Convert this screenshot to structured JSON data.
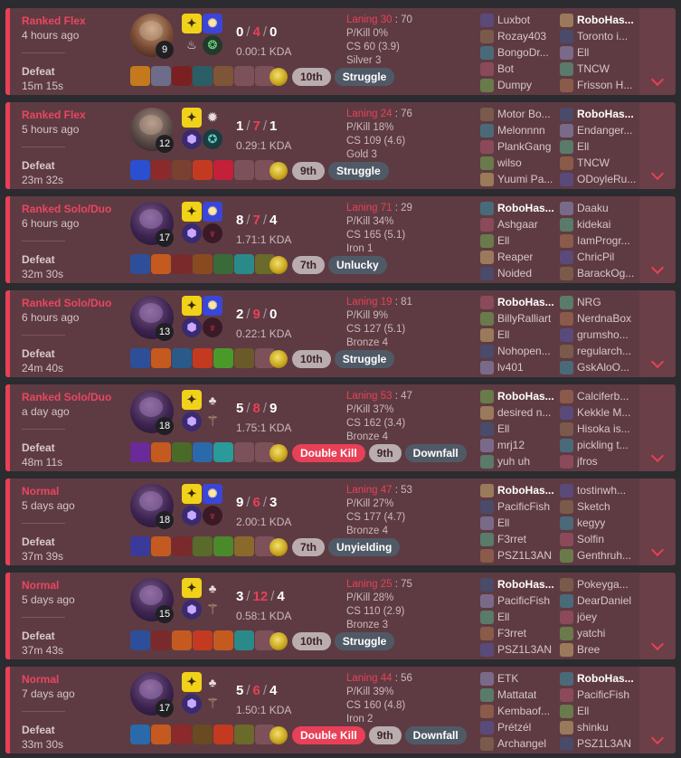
{
  "colors": {
    "loss_accent": "#e84057",
    "card_bg": "#5e3b42"
  },
  "matches": [
    {
      "queue": "Ranked Flex",
      "time_ago": "4 hours ago",
      "result": "Defeat",
      "duration": "15m 15s",
      "level": "9",
      "kills": "0",
      "deaths": "4",
      "assists": "0",
      "kda": "0.00:1 KDA",
      "laning_label": "Laning 30",
      "laning_opp": ": 70",
      "pkill": "P/Kill 0%",
      "cs": "CS 60 (3.9)",
      "rank": "Silver 3",
      "badges": [
        {
          "text": "10th",
          "kind": "rank"
        },
        {
          "text": "Struggle",
          "kind": "perf"
        }
      ],
      "team1": [
        "Luxbot",
        "Rozay403",
        "BongoDr...",
        "Bot",
        "Dumpy"
      ],
      "team2": [
        "RoboHas...",
        "Toronto i...",
        "Ell",
        "TNCW",
        "Frisson H..."
      ]
    },
    {
      "queue": "Ranked Flex",
      "time_ago": "5 hours ago",
      "result": "Defeat",
      "duration": "23m 32s",
      "level": "12",
      "kills": "1",
      "deaths": "7",
      "assists": "1",
      "kda": "0.29:1 KDA",
      "laning_label": "Laning 24",
      "laning_opp": ": 76",
      "pkill": "P/Kill 18%",
      "cs": "CS 109 (4.6)",
      "rank": "Gold 3",
      "badges": [
        {
          "text": "9th",
          "kind": "rank"
        },
        {
          "text": "Struggle",
          "kind": "perf"
        }
      ],
      "team1": [
        "Motor Bo...",
        "Melonnnn",
        "PlankGang",
        "wilso",
        "Yuumi Pa..."
      ],
      "team2": [
        "RoboHas...",
        "Endanger...",
        "Ell",
        "TNCW",
        "ODoyleRu..."
      ]
    },
    {
      "queue": "Ranked Solo/Duo",
      "time_ago": "6 hours ago",
      "result": "Defeat",
      "duration": "32m 30s",
      "level": "17",
      "kills": "8",
      "deaths": "7",
      "assists": "4",
      "kda": "1.71:1 KDA",
      "laning_label": "Laning 71",
      "laning_opp": ": 29",
      "pkill": "P/Kill 34%",
      "cs": "CS 165 (5.1)",
      "rank": "Iron 1",
      "badges": [
        {
          "text": "7th",
          "kind": "rank"
        },
        {
          "text": "Unlucky",
          "kind": "perf"
        }
      ],
      "team1": [
        "RoboHas...",
        "Ashgaar",
        "Ell",
        "Reaper",
        "Noided"
      ],
      "team2": [
        "Daaku",
        "kidekai",
        "IamProgr...",
        "ChricPil",
        "BarackOg..."
      ]
    },
    {
      "queue": "Ranked Solo/Duo",
      "time_ago": "6 hours ago",
      "result": "Defeat",
      "duration": "24m 40s",
      "level": "13",
      "kills": "2",
      "deaths": "9",
      "assists": "0",
      "kda": "0.22:1 KDA",
      "laning_label": "Laning 19",
      "laning_opp": ": 81",
      "pkill": "P/Kill 9%",
      "cs": "CS 127 (5.1)",
      "rank": "Bronze 4",
      "badges": [
        {
          "text": "10th",
          "kind": "rank"
        },
        {
          "text": "Struggle",
          "kind": "perf"
        }
      ],
      "team1": [
        "RoboHas...",
        "BillyRalliart",
        "Ell",
        "Nohopen...",
        "lv401"
      ],
      "team2": [
        "NRG",
        "NerdnaBox",
        "grumsho...",
        "regularch...",
        "GskAloO..."
      ]
    },
    {
      "queue": "Ranked Solo/Duo",
      "time_ago": "a day ago",
      "result": "Defeat",
      "duration": "48m 11s",
      "level": "18",
      "kills": "5",
      "deaths": "8",
      "assists": "9",
      "kda": "1.75:1 KDA",
      "laning_label": "Laning 53",
      "laning_opp": ": 47",
      "pkill": "P/Kill 37%",
      "cs": "CS 162 (3.4)",
      "rank": "Bronze 4",
      "badges": [
        {
          "text": "Double Kill",
          "kind": "mk"
        },
        {
          "text": "9th",
          "kind": "rank"
        },
        {
          "text": "Downfall",
          "kind": "perf"
        }
      ],
      "team1": [
        "RoboHas...",
        "desired n...",
        "Ell",
        "mrj12",
        "yuh uh"
      ],
      "team2": [
        "Calciferb...",
        "Kekkle M...",
        "Hisoka is...",
        "pickling t...",
        "jfros"
      ]
    },
    {
      "queue": "Normal",
      "time_ago": "5 days ago",
      "result": "Defeat",
      "duration": "37m 39s",
      "level": "18",
      "kills": "9",
      "deaths": "6",
      "assists": "3",
      "kda": "2.00:1 KDA",
      "laning_label": "Laning 47",
      "laning_opp": ": 53",
      "pkill": "P/Kill 27%",
      "cs": "CS 177 (4.7)",
      "rank": "Bronze 4",
      "badges": [
        {
          "text": "7th",
          "kind": "rank"
        },
        {
          "text": "Unyielding",
          "kind": "perf"
        }
      ],
      "team1": [
        "RoboHas...",
        "PacificFish",
        "Ell",
        "F3rret",
        "PSZ1L3AN"
      ],
      "team2": [
        "tostinwh...",
        "Sketch",
        "kegyy",
        "Solfin",
        "Genthruh..."
      ]
    },
    {
      "queue": "Normal",
      "time_ago": "5 days ago",
      "result": "Defeat",
      "duration": "37m 43s",
      "level": "15",
      "kills": "3",
      "deaths": "12",
      "assists": "4",
      "kda": "0.58:1 KDA",
      "laning_label": "Laning 25",
      "laning_opp": ": 75",
      "pkill": "P/Kill 28%",
      "cs": "CS 110 (2.9)",
      "rank": "Bronze 3",
      "badges": [
        {
          "text": "10th",
          "kind": "rank"
        },
        {
          "text": "Struggle",
          "kind": "perf"
        }
      ],
      "team1": [
        "RoboHas...",
        "PacificFish",
        "Ell",
        "F3rret",
        "PSZ1L3AN"
      ],
      "team2": [
        "Pokeyga...",
        "DearDaniel",
        "jöey",
        "yatchi",
        "Bree"
      ]
    },
    {
      "queue": "Normal",
      "time_ago": "7 days ago",
      "result": "Defeat",
      "duration": "33m 30s",
      "level": "17",
      "kills": "5",
      "deaths": "6",
      "assists": "4",
      "kda": "1.50:1 KDA",
      "laning_label": "Laning 44",
      "laning_opp": ": 56",
      "pkill": "P/Kill 39%",
      "cs": "CS 160 (4.8)",
      "rank": "Iron 2",
      "badges": [
        {
          "text": "Double Kill",
          "kind": "mk"
        },
        {
          "text": "9th",
          "kind": "rank"
        },
        {
          "text": "Downfall",
          "kind": "perf"
        }
      ],
      "team1": [
        "ETK",
        "Mattatat",
        "Kembaof...",
        "Prétzél",
        "Archangel"
      ],
      "team2": [
        "RoboHas...",
        "PacificFish",
        "Ell",
        "shinku",
        "PSZ1L3AN"
      ]
    }
  ]
}
